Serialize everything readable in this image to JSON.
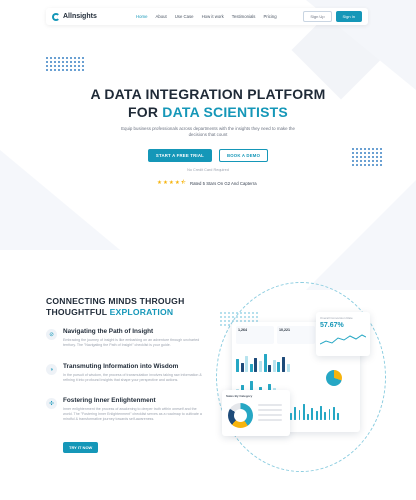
{
  "nav": {
    "brand": "Allnsights",
    "links": [
      "Home",
      "About",
      "Use Case",
      "How it work",
      "Testimonials",
      "Pricing"
    ],
    "signup_label": "Sign Up",
    "signin_label": "Sign In"
  },
  "hero": {
    "title_line1": "A DATA INTEGRATION PLATFORM",
    "title_line2_prefix": "FOR ",
    "title_line2_accent": "DATA SCIENTISTS",
    "subtitle": "Equip business professionals across departments with the insights they need to make the decisions that count",
    "primary_cta": "START A FREE TRIAL",
    "secondary_cta": "BOOK A DEMO",
    "no_card_note": "No Credit Card Required",
    "stars": 4.5,
    "rating_text": "Rated 5 Stars On G2 And Capterra"
  },
  "features_section": {
    "title_line1": "CONNECTING MINDS THROUGH",
    "title_line2_prefix": "THOUGHTFUL ",
    "title_line2_accent": "EXPLORATION",
    "items": [
      {
        "icon": "compass-icon",
        "title": "Navigating the Path of Insight",
        "text": "Embracing the journey of insight is like embarking on an adventure through uncharted territory. The \"Navigating the Path of Insight\" checklist is your guide."
      },
      {
        "icon": "brain-icon",
        "title": "Transmuting Information into Wisdom",
        "text": "In the pursuit of wisdom, the process of transmutation involves taking raw information & refining it into profound insights that shape your perspective and actions."
      },
      {
        "icon": "network-icon",
        "title": "Fostering Inner Enlightenment",
        "text": "Inner enlightenment the process of awakening to deeper truth within oneself and the world. The \"Fostering Inner Enlightenment\" checklist serves as a roadmap to cultivate a mindful & transformative journey towards self-awareness."
      }
    ],
    "cta": "TRY IT NOW"
  },
  "dashboard_mock": {
    "small_card_title": "Overall Conversion Rate",
    "small_card_value": "57.67%",
    "kpis": [
      "1,264",
      "10,221",
      "6,452"
    ],
    "donut_card_title": "Sales By Category"
  }
}
